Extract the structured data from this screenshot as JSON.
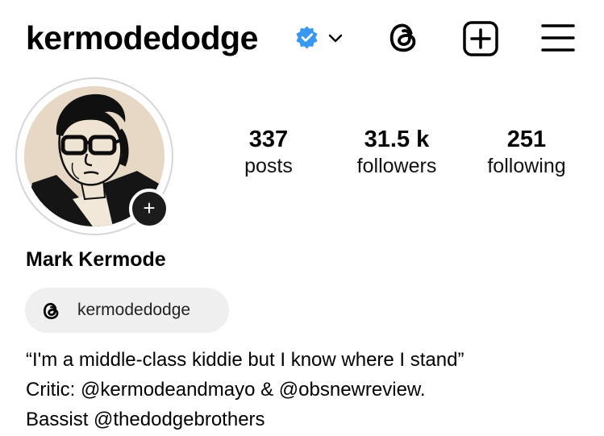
{
  "header": {
    "username": "kermodedodge",
    "verified_icon": "verified-badge-icon",
    "chevron_icon": "chevron-down-icon",
    "threads_icon": "threads-icon",
    "add_icon": "add-square-icon",
    "menu_icon": "hamburger-menu-icon"
  },
  "profile": {
    "avatar_icon": "profile-photo",
    "add_story_symbol": "+",
    "full_name": "Mark Kermode",
    "stats": [
      {
        "value": "337",
        "label": "posts"
      },
      {
        "value": "31.5 k",
        "label": "followers"
      },
      {
        "value": "251",
        "label": "following"
      }
    ],
    "threads_badge": {
      "icon": "threads-icon",
      "handle": "kermodedodge"
    },
    "bio": [
      "“I'm a middle-class kiddie but I know where I stand”",
      "Critic: @kermodeandmayo & @obsnewreview.",
      "Bassist @thedodgebrothers"
    ]
  },
  "colors": {
    "verified": "#3897f0",
    "pill_bg": "#efefef",
    "ring": "#d6d6d6"
  }
}
